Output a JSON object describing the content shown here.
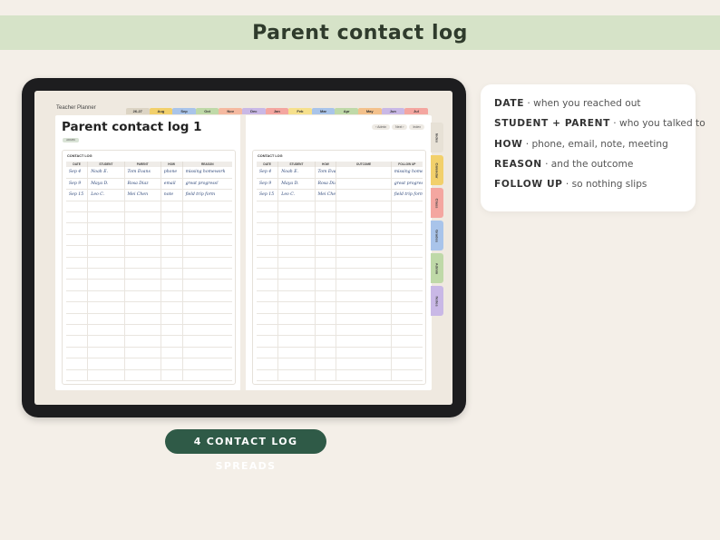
{
  "header": {
    "title": "Parent contact log"
  },
  "tablet": {
    "planner_label": "Teacher Planner",
    "month_tabs": [
      {
        "label": "26-27",
        "color": "#dcd4c4"
      },
      {
        "label": "Aug",
        "color": "#f2d06b"
      },
      {
        "label": "Sep",
        "color": "#a9c4ea"
      },
      {
        "label": "Oct",
        "color": "#bfd9a8"
      },
      {
        "label": "Nov",
        "color": "#f5b9a0"
      },
      {
        "label": "Dec",
        "color": "#c9b8e6"
      },
      {
        "label": "Jan",
        "color": "#f4a6a0"
      },
      {
        "label": "Feb",
        "color": "#f6e08c"
      },
      {
        "label": "Mar",
        "color": "#a9c4ea"
      },
      {
        "label": "Apr",
        "color": "#bfd9a8"
      },
      {
        "label": "May",
        "color": "#f3c18c"
      },
      {
        "label": "Jun",
        "color": "#c9b8e6"
      },
      {
        "label": "Jul",
        "color": "#f4a6a0"
      }
    ],
    "side_tabs": [
      {
        "label": "Index",
        "color": "#e7e1d6"
      },
      {
        "label": "Calendar",
        "color": "#f2d06b"
      },
      {
        "label": "Class",
        "color": "#f4a6a0"
      },
      {
        "label": "Grades",
        "color": "#a9c4ea"
      },
      {
        "label": "Admin",
        "color": "#bfd9a8"
      },
      {
        "label": "Notes",
        "color": "#c9b8e6"
      }
    ],
    "left_page": {
      "title": "Parent contact log 1",
      "chip": "ADMIN",
      "log_heading": "CONTACT LOG",
      "columns": [
        "DATE",
        "STUDENT",
        "PARENT",
        "HOW",
        "REASON"
      ],
      "rows": [
        [
          "Sep 4",
          "Noah E.",
          "Tom Evans",
          "phone",
          "missing homework"
        ],
        [
          "Sep 9",
          "Maya D.",
          "Rosa Diaz",
          "email",
          "great progress!"
        ],
        [
          "Sep 15",
          "Leo C.",
          "Mei Chen",
          "note",
          "field trip form"
        ]
      ]
    },
    "right_page": {
      "quick_links": [
        "‹ Admin",
        "Next ›",
        "Index"
      ],
      "log_heading": "CONTACT LOG",
      "columns": [
        "DATE",
        "STUDENT",
        "HOW",
        "OUTCOME",
        "FOLLOW UP"
      ],
      "rows": [
        [
          "Sep 4",
          "Noah E.",
          "Tom Evans phone",
          "",
          "missing homework"
        ],
        [
          "Sep 9",
          "Maya D.",
          "Rosa Diaz email",
          "",
          "great progress!"
        ],
        [
          "Sep 15",
          "Leo C.",
          "Mei Chen note",
          "",
          "field trip form"
        ]
      ]
    }
  },
  "badge": {
    "label": "4 CONTACT LOG SPREADS"
  },
  "legend": {
    "items": [
      {
        "key": "DATE",
        "desc": " · when you reached out"
      },
      {
        "key": "STUDENT + PARENT",
        "desc": " · who you talked to"
      },
      {
        "key": "HOW",
        "desc": " · phone, email, note, meeting"
      },
      {
        "key": "REASON",
        "desc": " · and the outcome"
      },
      {
        "key": "FOLLOW UP",
        "desc": " · so nothing slips"
      }
    ]
  }
}
